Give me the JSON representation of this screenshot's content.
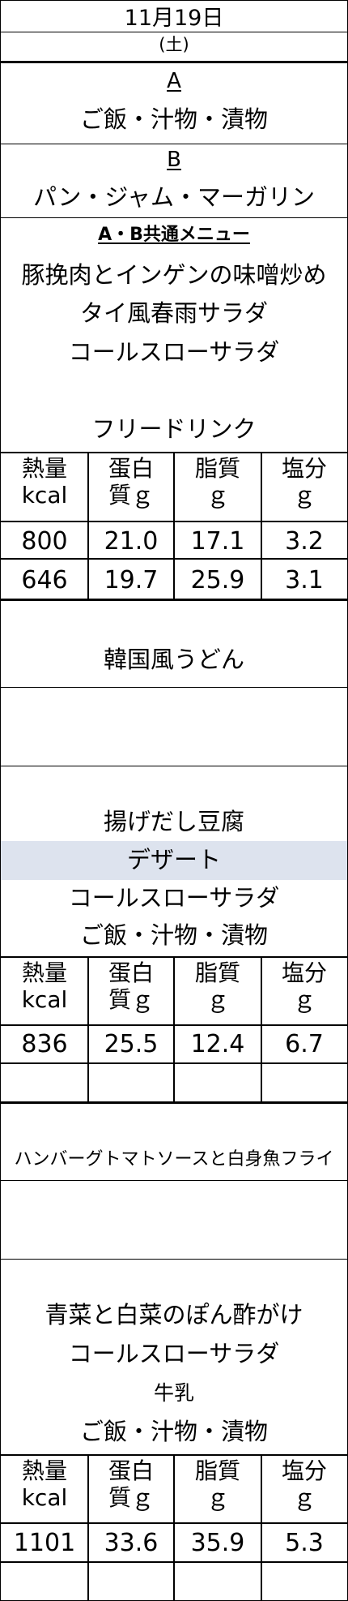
{
  "header": {
    "date": "11月19日",
    "weekday": "(土)"
  },
  "set_a": {
    "label": "A",
    "items": "ご飯・汁物・漬物"
  },
  "set_b": {
    "label": "B",
    "items": "パン・ジャム・マーガリン"
  },
  "breakfast": {
    "common_label": "A・B共通メニュー",
    "dishes": [
      "豚挽肉とインゲンの味噌炒め",
      "タイ風春雨サラダ",
      "コールスローサラダ"
    ],
    "drink": "フリードリンク"
  },
  "nutrition_headers": {
    "energy": "熱量\nkcal",
    "protein": "蛋白\n質ｇ",
    "fat": "脂質\nｇ",
    "salt": "塩分\nｇ"
  },
  "breakfast_nutrition": [
    [
      "800",
      "21.0",
      "17.1",
      "3.2"
    ],
    [
      "646",
      "19.7",
      "25.9",
      "3.1"
    ]
  ],
  "lunch": {
    "main": "韓国風うどん",
    "side": "揚げだし豆腐",
    "dessert": "デザート",
    "salad": "コールスローサラダ",
    "staple": "ご飯・汁物・漬物",
    "nutrition": [
      "836",
      "25.5",
      "12.4",
      "6.7"
    ]
  },
  "dinner": {
    "main": "ハンバーグトマトソースと白身魚フライ",
    "side": "青菜と白菜のぽん酢がけ",
    "salad": "コールスローサラダ",
    "milk": "牛乳",
    "staple": "ご飯・汁物・漬物",
    "nutrition": [
      "1101",
      "33.6",
      "35.9",
      "5.3"
    ]
  },
  "colors": {
    "dessert_highlight": "#dde3ee",
    "border": "#000000"
  }
}
